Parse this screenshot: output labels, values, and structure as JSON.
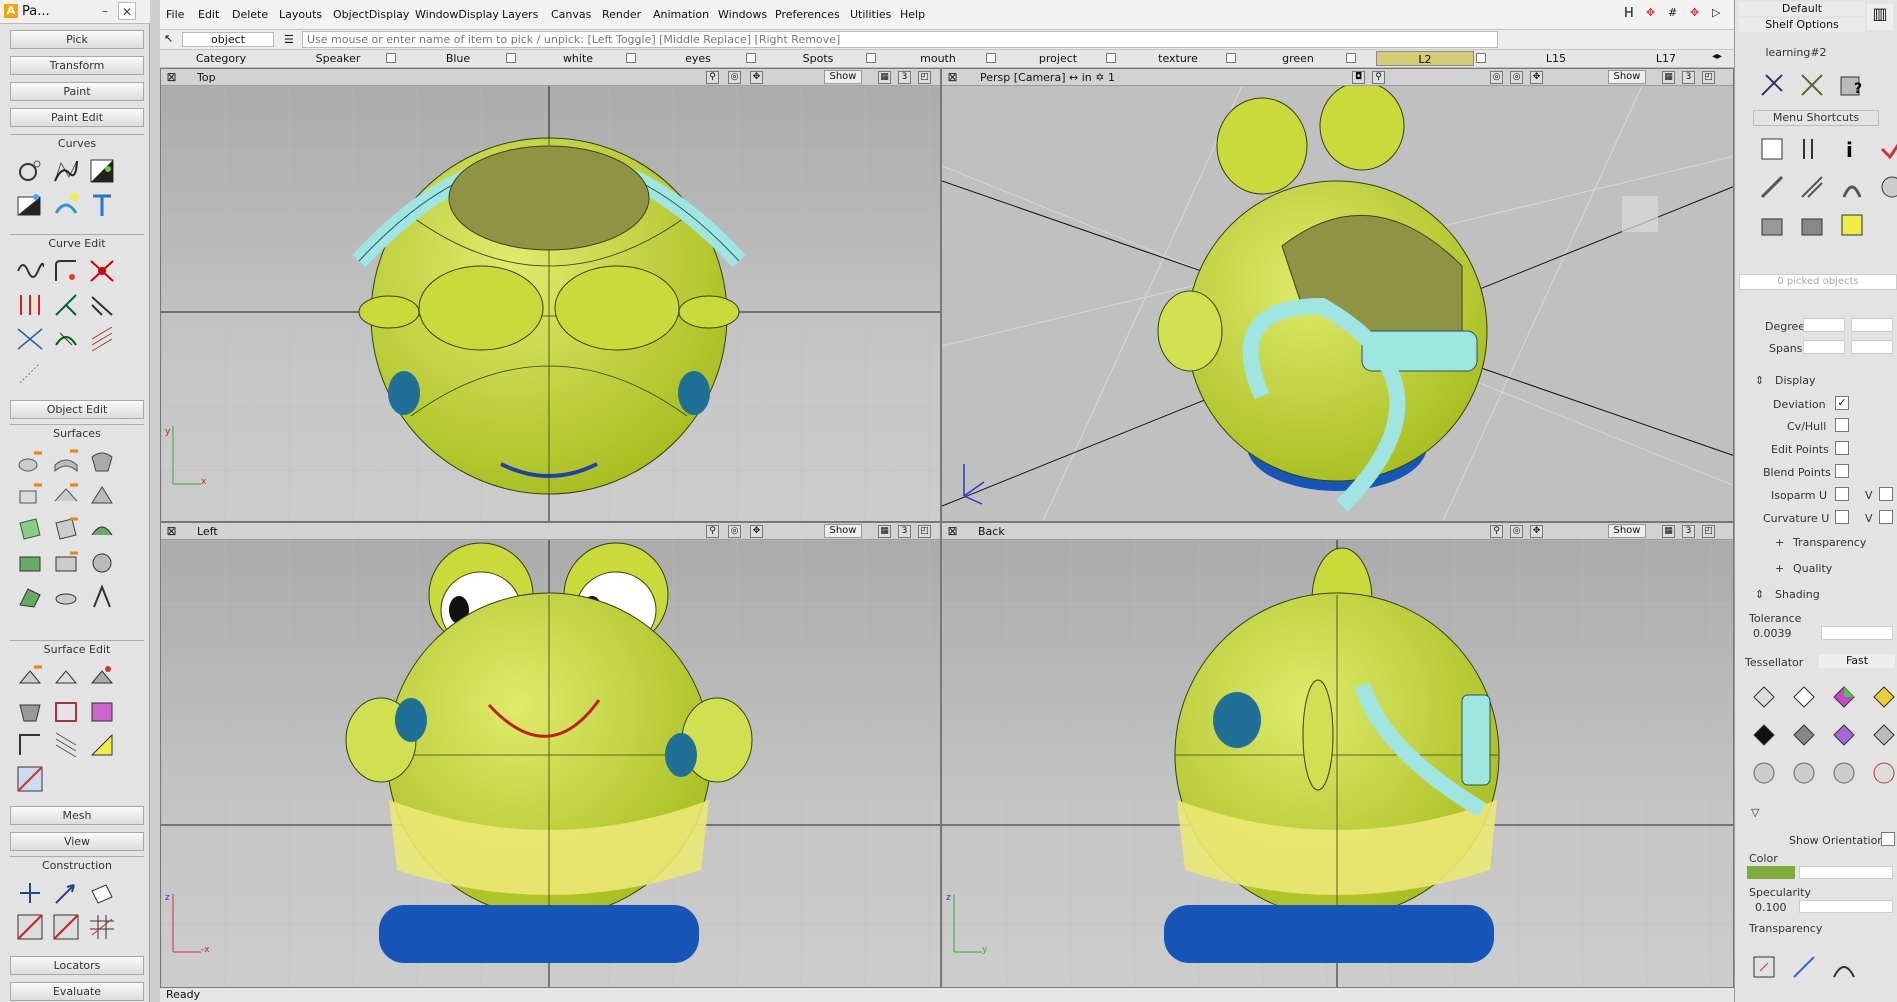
{
  "palette": {
    "title": "Pa...",
    "buttons": {
      "pick": "Pick",
      "transform": "Transform",
      "paint": "Paint",
      "paint_edit": "Paint Edit",
      "mesh": "Mesh",
      "view": "View",
      "locators": "Locators",
      "evaluate": "Evaluate"
    },
    "sections": {
      "curves": "Curves",
      "curve_edit": "Curve Edit",
      "object_edit": "Object Edit",
      "surfaces": "Surfaces",
      "surface_edit": "Surface Edit",
      "construction": "Construction"
    }
  },
  "menubar": [
    "File",
    "Edit",
    "Delete",
    "Layouts",
    "ObjectDisplay",
    "WindowDisplay",
    "Layers",
    "Canvas",
    "Render",
    "Animation",
    "Windows",
    "Preferences",
    "Utilities",
    "Help"
  ],
  "pickbar": {
    "pick_type": "object",
    "hint": "Use mouse or enter name of item to pick / unpick: [Left Toggle] [Middle Replace] [Right Remove]"
  },
  "layers": [
    "Category",
    "Speaker",
    "Blue",
    "white",
    "eyes",
    "Spots",
    "mouth",
    "project",
    "texture",
    "green",
    "L2",
    "L15",
    "L17"
  ],
  "viewports": {
    "top": {
      "name": "Top",
      "show": "Show",
      "num": "3",
      "axis_x": "x",
      "axis_y": "y"
    },
    "persp": {
      "name": "Persp [Camera]  ↔ in  ✡ 1",
      "show": "Show",
      "num": "3"
    },
    "left": {
      "name": "Left",
      "show": "Show",
      "num": "3",
      "axis_x": "-x",
      "axis_y": "z"
    },
    "back": {
      "name": "Back",
      "show": "Show",
      "num": "3",
      "axis_x": "y",
      "axis_y": "z"
    }
  },
  "right": {
    "default": "Default",
    "shelf_options": "Shelf Options",
    "shelf_tab": "learning#2",
    "menu_shortcuts": "Menu Shortcuts",
    "picked": "0 picked objects",
    "degree": "Degree",
    "spans": "Spans",
    "display": "Display",
    "deviation": "Deviation",
    "cv_hull": "Cv/Hull",
    "edit_points": "Edit Points",
    "blend_points": "Blend Points",
    "isoparm_u": "Isoparm U",
    "isoparm_v": "V",
    "curvature_u": "Curvature U",
    "curvature_v": "V",
    "transparency_grp": "Transparency",
    "quality": "Quality",
    "shading": "Shading",
    "tolerance": "Tolerance",
    "tolerance_val": "0.0039",
    "tessellator": "Tessellator",
    "tessellator_val": "Fast",
    "show_orientation": "Show Orientation",
    "color": "Color",
    "specularity": "Specularity",
    "specularity_val": "0.100",
    "transparency": "Transparency"
  },
  "status": "Ready"
}
